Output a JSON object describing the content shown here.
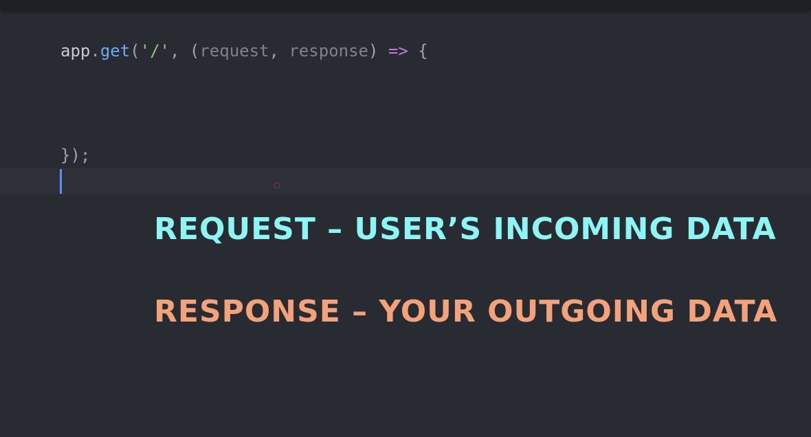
{
  "code": {
    "line1": {
      "app": "app",
      "dot": ".",
      "get": "get",
      "open_paren": "(",
      "route": "'/'",
      "comma": ", ",
      "params_open": "(",
      "request": "request",
      "param_sep": ", ",
      "response": "response",
      "params_close": ")",
      "space1": " ",
      "arrow": "=>",
      "space2": " ",
      "brace": "{"
    },
    "line2": {
      "closing": "});"
    }
  },
  "captions": {
    "request": "REQUEST – USER’S INCOMING DATA",
    "response": "RESPONSE – YOUR OUTGOING DATA"
  },
  "colors": {
    "background": "#292b33",
    "request_caption": "#8ef5f5",
    "response_caption": "#f4a27a",
    "cursor": "#5b8ff0"
  }
}
